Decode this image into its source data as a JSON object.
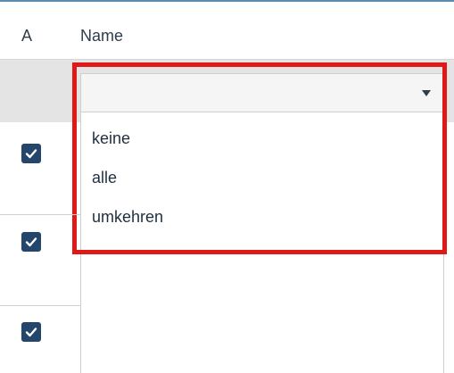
{
  "table": {
    "columns": [
      {
        "label": "A"
      },
      {
        "label": "Name"
      }
    ],
    "rows": [
      {
        "checked": true
      },
      {
        "checked": true
      },
      {
        "checked": true
      }
    ]
  },
  "filter": {
    "selected": "",
    "options": [
      "keine",
      "alle",
      "umkehren"
    ]
  },
  "colors": {
    "checkbox": "#24466b",
    "highlight": "#e11818",
    "accent_rule": "#5b8db3"
  }
}
